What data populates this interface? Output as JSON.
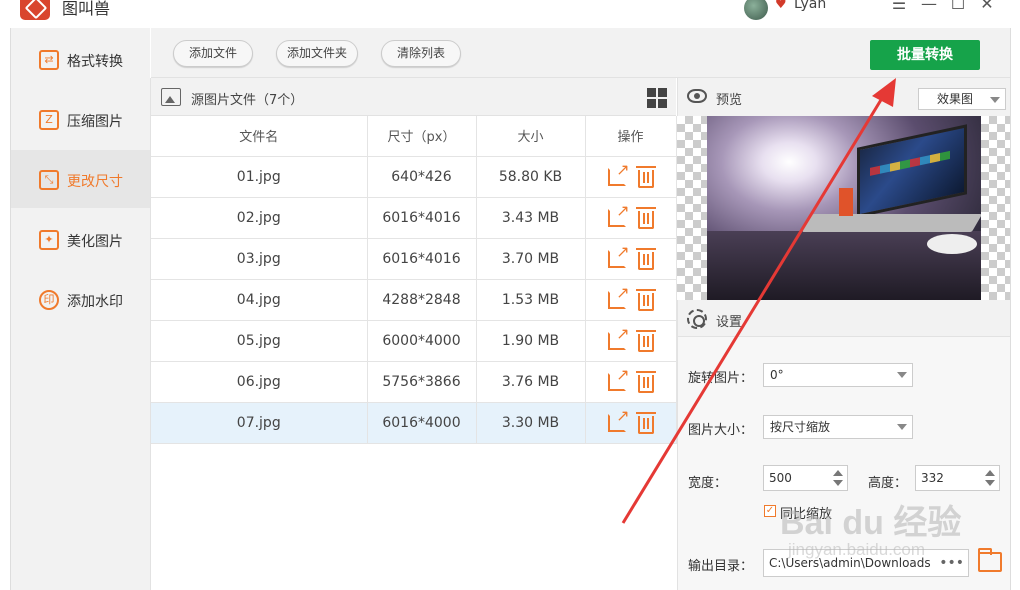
{
  "titlebar": {
    "app_name": "图叫兽",
    "username": "Lyan",
    "minimize_label": "—",
    "restore_label": "☐",
    "close_label": "✕",
    "menu_label": "☰"
  },
  "sidebar": {
    "items": [
      {
        "label": "格式转换",
        "icon": "format-convert-icon",
        "active": false
      },
      {
        "label": "压缩图片",
        "icon": "compress-icon",
        "active": false
      },
      {
        "label": "更改尺寸",
        "icon": "resize-icon",
        "active": true
      },
      {
        "label": "美化图片",
        "icon": "beautify-icon",
        "active": false
      },
      {
        "label": "添加水印",
        "icon": "watermark-icon",
        "active": false
      }
    ]
  },
  "toolbar": {
    "add_file": "添加文件",
    "add_folder": "添加文件夹",
    "clear_list": "清除列表",
    "batch_convert": "批量转换"
  },
  "file_list": {
    "title": "源图片文件（7个）",
    "columns": [
      "文件名",
      "尺寸（px）",
      "大小",
      "操作"
    ],
    "rows": [
      {
        "name": "01.jpg",
        "size_px": "640*426",
        "size": "58.80 KB",
        "selected": false
      },
      {
        "name": "02.jpg",
        "size_px": "6016*4016",
        "size": "3.43 MB",
        "selected": false
      },
      {
        "name": "03.jpg",
        "size_px": "6016*4016",
        "size": "3.70 MB",
        "selected": false
      },
      {
        "name": "04.jpg",
        "size_px": "4288*2848",
        "size": "1.53 MB",
        "selected": false
      },
      {
        "name": "05.jpg",
        "size_px": "6000*4000",
        "size": "1.90 MB",
        "selected": false
      },
      {
        "name": "06.jpg",
        "size_px": "5756*3866",
        "size": "3.76 MB",
        "selected": false
      },
      {
        "name": "07.jpg",
        "size_px": "6016*4000",
        "size": "3.30 MB",
        "selected": true
      }
    ]
  },
  "preview": {
    "title": "预览",
    "mode": "效果图"
  },
  "settings": {
    "title": "设置",
    "rotate_label": "旋转图片：",
    "rotate_value": "0°",
    "size_label": "图片大小：",
    "size_value": "按尺寸缩放",
    "width_label": "宽度：",
    "width_value": "500",
    "height_label": "高度：",
    "height_value": "332",
    "keep_ratio_label": "同比缩放",
    "keep_ratio_checked": true,
    "output_label": "输出目录：",
    "output_path": "C:\\Users\\admin\\Downloads",
    "browse_dots": "•••"
  },
  "watermark": {
    "main": "Bai du 经验",
    "sub": "jingyan.baidu.com"
  },
  "colors": {
    "accent": "#f07a2c",
    "primary_button": "#16a34a",
    "annotation_arrow": "#e53935",
    "selected_row": "#e6f2fb"
  }
}
